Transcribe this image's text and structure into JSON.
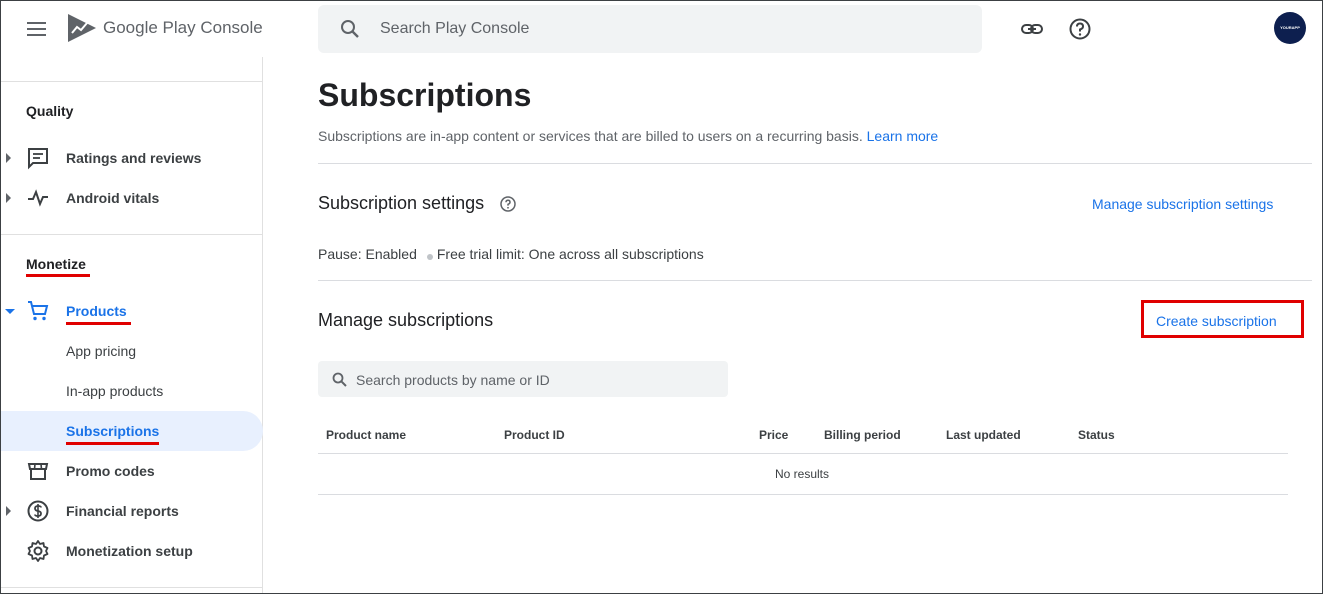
{
  "app": {
    "brand": "Google Play Console",
    "search_placeholder": "Search Play Console",
    "avatar_text": "YOURAPP"
  },
  "sidebar": {
    "sections": [
      {
        "title": "Quality"
      },
      {
        "title": "Monetize"
      }
    ],
    "items": [
      {
        "label": "Ratings and reviews",
        "icon": "reviews-icon",
        "expandable": true
      },
      {
        "label": "Android vitals",
        "icon": "vitals-icon",
        "expandable": true
      },
      {
        "label": "Products",
        "icon": "cart-icon",
        "expanded": true
      },
      {
        "label": "App pricing"
      },
      {
        "label": "In-app products"
      },
      {
        "label": "Subscriptions",
        "selected": true
      },
      {
        "label": "Promo codes",
        "icon": "store-icon"
      },
      {
        "label": "Financial reports",
        "icon": "dollar-icon",
        "expandable": true
      },
      {
        "label": "Monetization setup",
        "icon": "gear-icon"
      }
    ]
  },
  "page": {
    "title": "Subscriptions",
    "description": "Subscriptions are in-app content or services that are billed to users on a recurring basis.",
    "learn_more": "Learn more"
  },
  "subscription_settings": {
    "title": "Subscription settings",
    "manage_link": "Manage subscription settings",
    "pause": "Pause: Enabled",
    "free_trial": "Free trial limit: One across all subscriptions"
  },
  "manage_subscriptions": {
    "title": "Manage subscriptions",
    "create_button": "Create subscription",
    "search_placeholder": "Search products by name or ID",
    "columns": [
      "Product name",
      "Product ID",
      "Price",
      "Billing period",
      "Last updated",
      "Status"
    ],
    "empty_text": "No results"
  },
  "colors": {
    "accent": "#1a73e8",
    "highlight": "#e00000",
    "selected_bg": "#e8f0fe"
  }
}
